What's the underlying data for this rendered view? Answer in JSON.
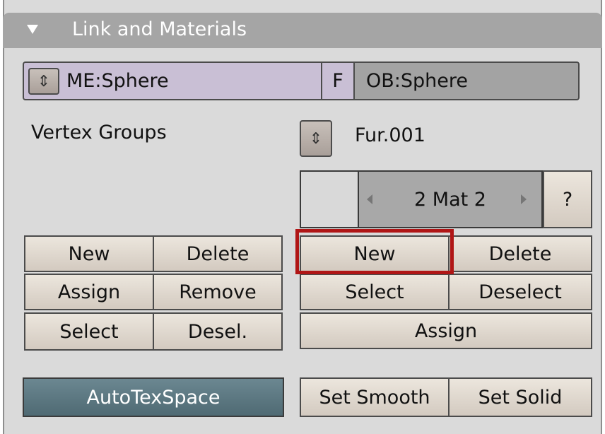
{
  "panel": {
    "title": "Link and Materials"
  },
  "link": {
    "mesh_name": "ME:Sphere",
    "fake_user": "F",
    "object_name": "OB:Sphere"
  },
  "vertex_groups": {
    "label": "Vertex Groups",
    "new": "New",
    "delete": "Delete",
    "assign": "Assign",
    "remove": "Remove",
    "select": "Select",
    "deselect": "Desel."
  },
  "materials": {
    "current_name": "Fur.001",
    "index_display": "2 Mat 2",
    "help": "?",
    "new": "New",
    "delete": "Delete",
    "select": "Select",
    "deselect": "Deselect",
    "assign": "Assign"
  },
  "bottom": {
    "autotexspace": "AutoTexSpace",
    "set_smooth": "Set Smooth",
    "set_solid": "Set Solid"
  },
  "colors": {
    "header": "#a5a5a5",
    "panel_bg": "#dadada",
    "mesh_field": "#c9bfd5",
    "object_field": "#a3a3a3",
    "autotex_active": "#5a7580",
    "highlight_box": "#b01616"
  }
}
